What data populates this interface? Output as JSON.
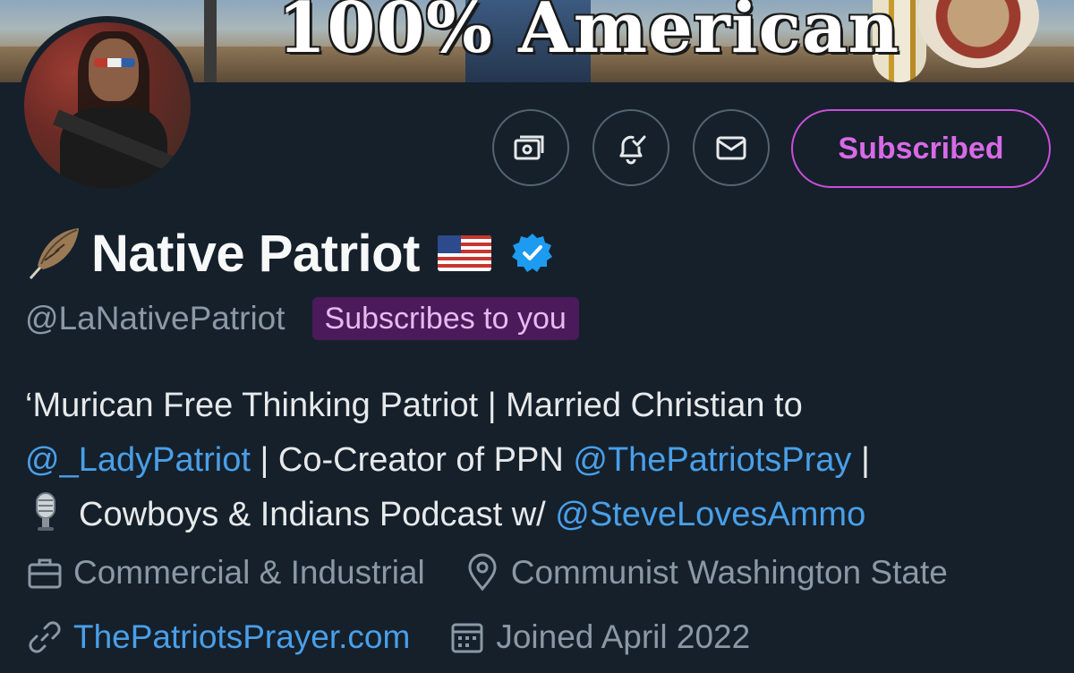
{
  "banner": {
    "title": "100% American"
  },
  "profile": {
    "display_name": "Native Patriot",
    "handle": "@LaNativePatriot",
    "subscribes_badge": "Subscribes to you",
    "subscribed_label": "Subscribed"
  },
  "bio": {
    "line1": "‘Murican Free Thinking Patriot | Married Christian to",
    "mention1": "@_LadyPatriot",
    "line2_mid": " | Co-Creator of PPN ",
    "mention2": "@ThePatriotsPray",
    "line2_end": " |",
    "line3": "Cowboys & Indians Podcast w/ ",
    "mention3": "@SteveLovesAmmo"
  },
  "meta": {
    "category": "Commercial & Industrial",
    "location": "Communist Washington State",
    "website": "ThePatriotsPrayer.com",
    "joined": "Joined April 2022"
  },
  "colors": {
    "background": "#15202b",
    "accent_link": "#4a9fe8",
    "subscribe_purple": "#c94fd8",
    "muted": "#8b98a5"
  }
}
